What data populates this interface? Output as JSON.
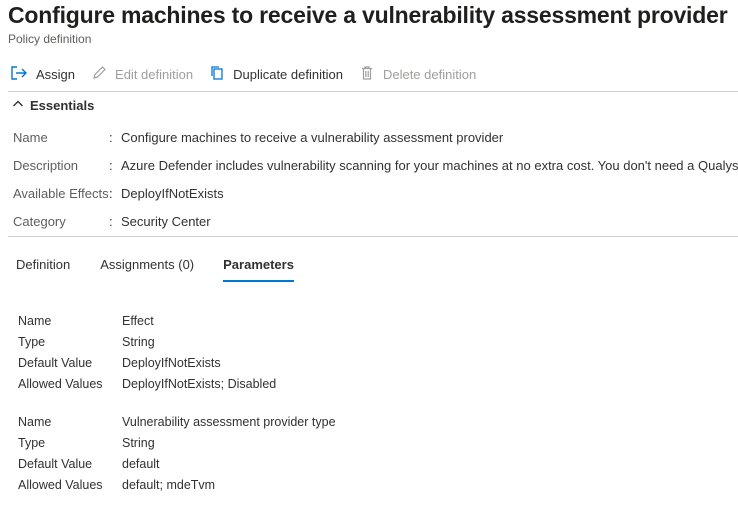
{
  "header": {
    "title": "Configure machines to receive a vulnerability assessment provider",
    "subtitle": "Policy definition"
  },
  "toolbar": {
    "assign": "Assign",
    "edit": "Edit definition",
    "duplicate": "Duplicate definition",
    "delete": "Delete definition"
  },
  "essentials": {
    "toggle_label": "Essentials",
    "rows": [
      {
        "label": "Name",
        "value": "Configure machines to receive a vulnerability assessment provider"
      },
      {
        "label": "Description",
        "value": "Azure Defender includes vulnerability scanning for your machines at no extra cost. You don't need a Qualys"
      },
      {
        "label": "Available Effects",
        "value": "DeployIfNotExists"
      },
      {
        "label": "Category",
        "value": "Security Center"
      }
    ],
    "separator": ":"
  },
  "tabs": [
    {
      "label": "Definition",
      "active": false
    },
    {
      "label": "Assignments (0)",
      "active": false
    },
    {
      "label": "Parameters",
      "active": true
    }
  ],
  "parameters": [
    {
      "rows": [
        {
          "label": "Name",
          "value": "Effect"
        },
        {
          "label": "Type",
          "value": "String"
        },
        {
          "label": "Default Value",
          "value": "DeployIfNotExists"
        },
        {
          "label": "Allowed Values",
          "value": "DeployIfNotExists; Disabled"
        }
      ]
    },
    {
      "rows": [
        {
          "label": "Name",
          "value": "Vulnerability assessment provider type"
        },
        {
          "label": "Type",
          "value": "String"
        },
        {
          "label": "Default Value",
          "value": "default"
        },
        {
          "label": "Allowed Values",
          "value": "default; mdeTvm"
        }
      ]
    }
  ],
  "colors": {
    "accent": "#0078d4",
    "text": "#323130",
    "muted": "#605e5c",
    "disabled": "#a19f9d"
  }
}
